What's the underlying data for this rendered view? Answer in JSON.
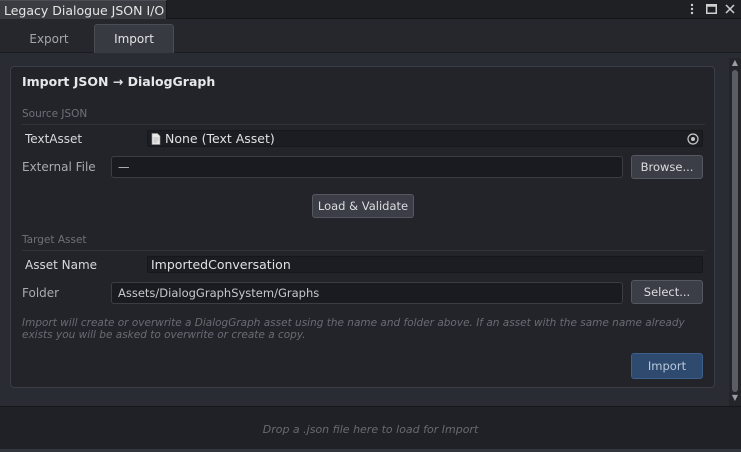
{
  "window": {
    "title": "Legacy Dialogue JSON I/O",
    "controls": [
      "kebab-menu-icon",
      "maximize-icon",
      "close-icon"
    ]
  },
  "tabs": [
    {
      "label": "Export",
      "active": false
    },
    {
      "label": "Import",
      "active": true
    }
  ],
  "panel": {
    "title": "Import JSON → DialogGraph",
    "source_section": {
      "label": "Source JSON",
      "text_asset_label": "TextAsset",
      "text_asset_value": "None (Text Asset)",
      "external_file_label": "External File",
      "external_file_value": "—",
      "browse_label": "Browse...",
      "load_validate_label": "Load & Validate"
    },
    "target_section": {
      "label": "Target Asset",
      "asset_name_label": "Asset Name",
      "asset_name_value": "ImportedConversation",
      "folder_label": "Folder",
      "folder_value": "Assets/DialogGraphSystem/Graphs",
      "select_label": "Select..."
    },
    "help_text": "Import will create or overwrite a DialogGraph asset using the name and folder above. If an asset with the same name already exists you will be asked to overwrite or create a copy.",
    "import_label": "Import"
  },
  "dropzone": {
    "text": "Drop a .json file here to load for Import"
  },
  "colors": {
    "background": "#2a2c33",
    "panel": "#22242a",
    "primary_button": "#2e4a6e"
  }
}
